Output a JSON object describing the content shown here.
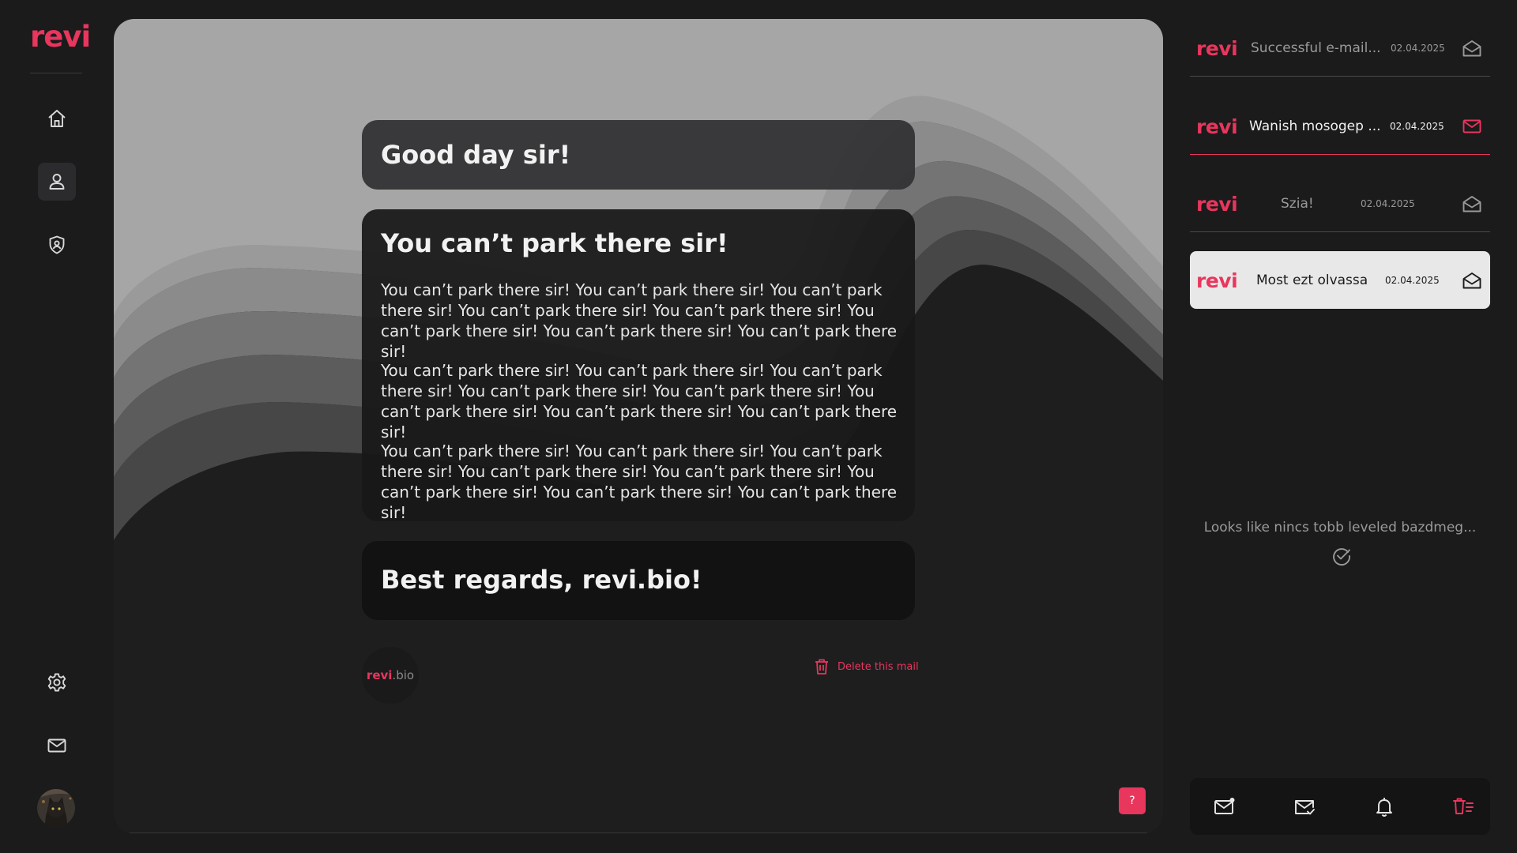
{
  "brand": {
    "logo": "revi",
    "chip_brand": "revi",
    "chip_suffix": ".bio"
  },
  "colors": {
    "accent": "#e8365d",
    "background": "#1b1b1c",
    "panel": "#1e1e1f",
    "text": "#f2f2f2",
    "muted": "#9a9a9a"
  },
  "sidebar": {
    "items": [
      {
        "name": "home",
        "icon": "home-icon"
      },
      {
        "name": "profile",
        "icon": "user-icon",
        "active": true
      },
      {
        "name": "security",
        "icon": "shield-icon"
      },
      {
        "name": "settings",
        "icon": "gear-icon"
      },
      {
        "name": "mail",
        "icon": "mail-icon"
      }
    ],
    "avatar": "cat-avatar"
  },
  "message": {
    "greeting": "Good day sir!",
    "title": "You can’t park there sir!",
    "paragraphs": [
      "You can’t park there sir! You can’t park there sir! You can’t park there sir! You can’t park there sir! You can’t park there sir! You can’t park there sir! You can’t park there sir! You can’t park there sir!",
      "You can’t park there sir! You can’t park there sir! You can’t park there sir! You can’t park there sir! You can’t park there sir! You can’t park there sir! You can’t park there sir! You can’t park there sir!",
      "You can’t park there sir! You can’t park there sir! You can’t park there sir! You can’t park there sir! You can’t park there sir! You can’t park there sir! You can’t park there sir! You can’t park there sir!"
    ],
    "signoff": "Best regards, revi.bio!",
    "delete_label": "Delete this mail",
    "help_label": "?"
  },
  "inbox": {
    "items": [
      {
        "logo": "revi",
        "subject": "Successful e-mail...",
        "date": "02.04.2025",
        "state": "read",
        "icon": "mail-open-icon"
      },
      {
        "logo": "revi",
        "subject": "Wanish mosogep ...",
        "date": "02.04.2025",
        "state": "unread",
        "icon": "mail-icon"
      },
      {
        "logo": "revi",
        "subject": "Szia!",
        "date": "02.04.2025",
        "state": "read",
        "icon": "mail-open-icon"
      },
      {
        "logo": "revi",
        "subject": "Most ezt olvassa",
        "date": "02.04.2025",
        "state": "selected",
        "icon": "mail-open-icon"
      }
    ],
    "empty_message": "Looks like nincs tobb leveled bazdmeg..."
  },
  "bottom_bar": [
    {
      "name": "new-mail",
      "icon": "mail-badge-icon"
    },
    {
      "name": "read-mail",
      "icon": "mail-check-icon"
    },
    {
      "name": "notifications",
      "icon": "bell-icon"
    },
    {
      "name": "delete-list",
      "icon": "trash-list-icon"
    }
  ]
}
